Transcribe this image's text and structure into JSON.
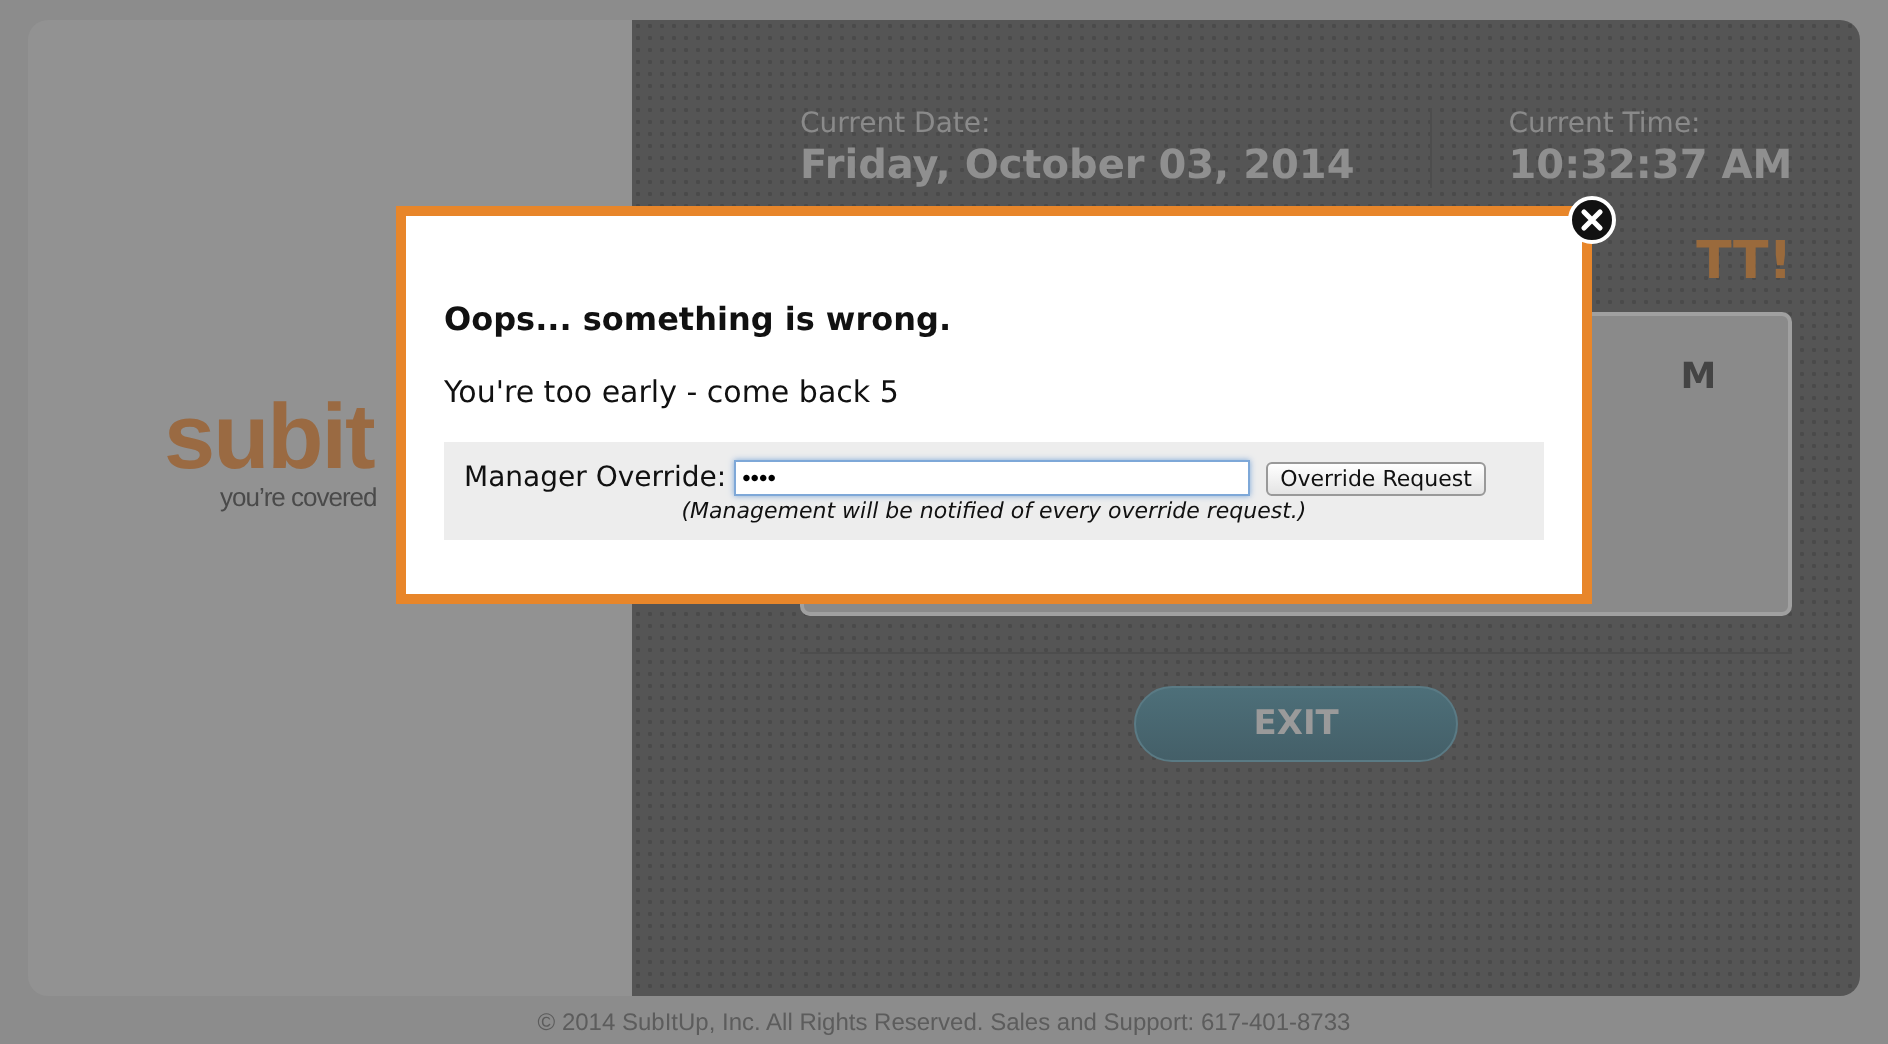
{
  "logo": {
    "wordmark": "subit",
    "tagline": "you’re covered"
  },
  "clock": {
    "date_label": "Current Date:",
    "date": "Friday, October 03, 2014",
    "time_label": "Current Time:",
    "time": "10:32:37 AM"
  },
  "greeting": "TT!",
  "panel": {
    "text": "M"
  },
  "exit_button": "EXIT",
  "footer": "© 2014 SubItUp, Inc. All Rights Reserved. Sales and Support: 617-401-8733",
  "dialog": {
    "title": "Oops... something is wrong.",
    "message": "You're too early - come back 5",
    "override": {
      "label": "Manager Override:",
      "value": "••••",
      "focused": true,
      "button": "Override Request",
      "note": "(Management will be notified of every override request.)"
    }
  }
}
